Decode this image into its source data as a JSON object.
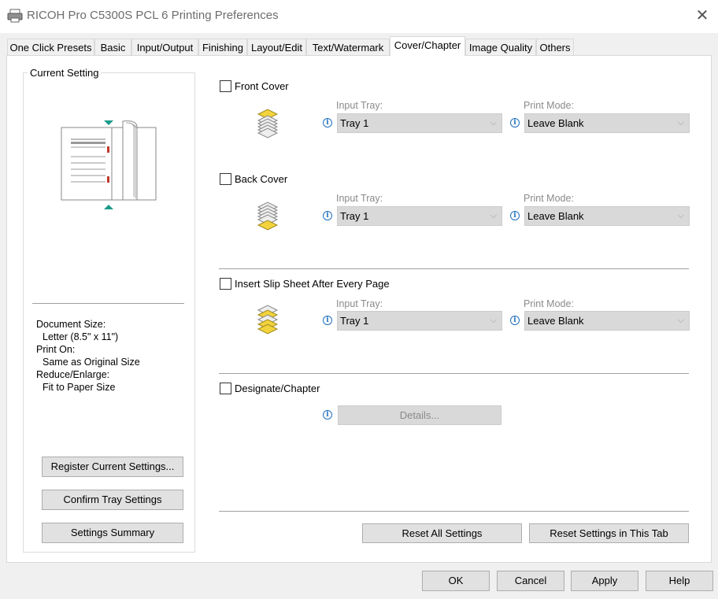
{
  "window": {
    "title": "RICOH Pro C5300S PCL 6 Printing Preferences",
    "close_symbol": "✕"
  },
  "tabs": [
    {
      "label": "One Click Presets"
    },
    {
      "label": "Basic"
    },
    {
      "label": "Input/Output"
    },
    {
      "label": "Finishing"
    },
    {
      "label": "Layout/Edit"
    },
    {
      "label": "Text/Watermark"
    },
    {
      "label": "Cover/Chapter",
      "active": true
    },
    {
      "label": "Image Quality"
    },
    {
      "label": "Others"
    }
  ],
  "current_setting": {
    "title": "Current Setting",
    "lines": [
      "Document Size:",
      "Letter (8.5\" x 11\")",
      "Print On:",
      "Same as Original Size",
      "Reduce/Enlarge:",
      "Fit to Paper Size"
    ],
    "buttons": {
      "register": "Register Current Settings...",
      "confirm_tray": "Confirm Tray Settings",
      "summary": "Settings Summary"
    }
  },
  "sections": {
    "front_cover": {
      "label": "Front Cover",
      "checked": false,
      "input_tray_label": "Input Tray:",
      "input_tray_value": "Tray 1",
      "print_mode_label": "Print Mode:",
      "print_mode_value": "Leave Blank"
    },
    "back_cover": {
      "label": "Back Cover",
      "checked": false,
      "input_tray_label": "Input Tray:",
      "input_tray_value": "Tray 1",
      "print_mode_label": "Print Mode:",
      "print_mode_value": "Leave Blank"
    },
    "slip_sheet": {
      "label": "Insert Slip Sheet After Every Page",
      "checked": false,
      "input_tray_label": "Input Tray:",
      "input_tray_value": "Tray 1",
      "print_mode_label": "Print Mode:",
      "print_mode_value": "Leave Blank"
    },
    "designate": {
      "label": "Designate/Chapter",
      "checked": false,
      "details_label": "Details..."
    }
  },
  "bottom_buttons": {
    "reset_all": "Reset All Settings",
    "reset_tab": "Reset Settings in This Tab"
  },
  "dialog_buttons": {
    "ok": "OK",
    "cancel": "Cancel",
    "apply": "Apply",
    "help": "Help"
  },
  "icons": {
    "info_glyph": "i",
    "chevron_glyph": "⌵"
  },
  "colors": {
    "paper_yellow": "#f2d33c",
    "accent_teal": "#1a9a8a",
    "info_blue": "#1f6fbf"
  }
}
